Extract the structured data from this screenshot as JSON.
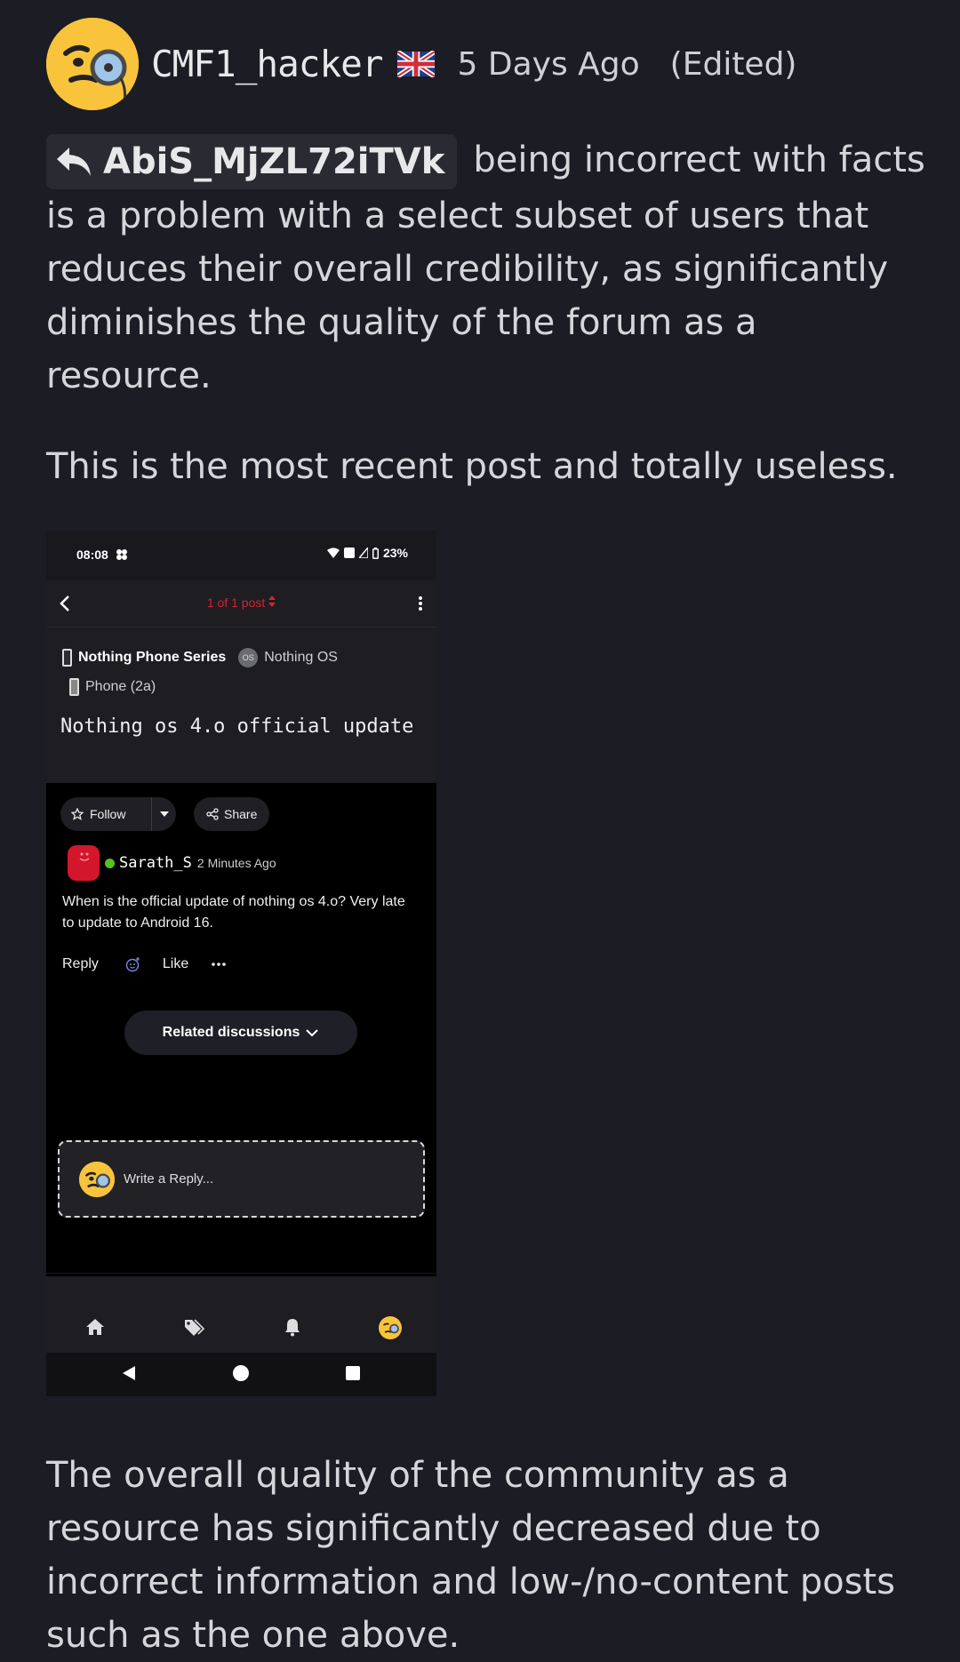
{
  "post": {
    "author": "CMF1_hacker",
    "time": "5 Days Ago",
    "edited": "(Edited)",
    "mention": "AbiS_MjZL72iTVk",
    "paragraph1_rest": "being incorrect with facts is a problem with a select subset of users that reduces their overall credibility, as significantly diminishes the quality of the forum as a resource.",
    "paragraph2": "This is the most recent post and totally useless.",
    "paragraph3": "The overall quality of the community as a resource has significantly decreased due to incorrect information and low-/no-content posts such as the one above."
  },
  "screenshot": {
    "status": {
      "time": "08:08",
      "battery": "23%"
    },
    "nav": {
      "post_counter": "1 of 1 post"
    },
    "categories": [
      "Nothing Phone Series",
      "Nothing OS",
      "Phone (2a)"
    ],
    "os_badge": "OS",
    "title": "Nothing os 4.o official update",
    "follow_label": "Follow",
    "share_label": "Share",
    "author": "Sarath_S",
    "time": "2 Minutes Ago",
    "body": "When is the official update of nothing os 4.o? Very late to update to Android 16.",
    "reply_label": "Reply",
    "like_label": "Like",
    "related_label": "Related discussions",
    "reply_placeholder": "Write a Reply...",
    "colors": {
      "accent_red": "#d3242f",
      "online_green": "#58c121"
    }
  }
}
